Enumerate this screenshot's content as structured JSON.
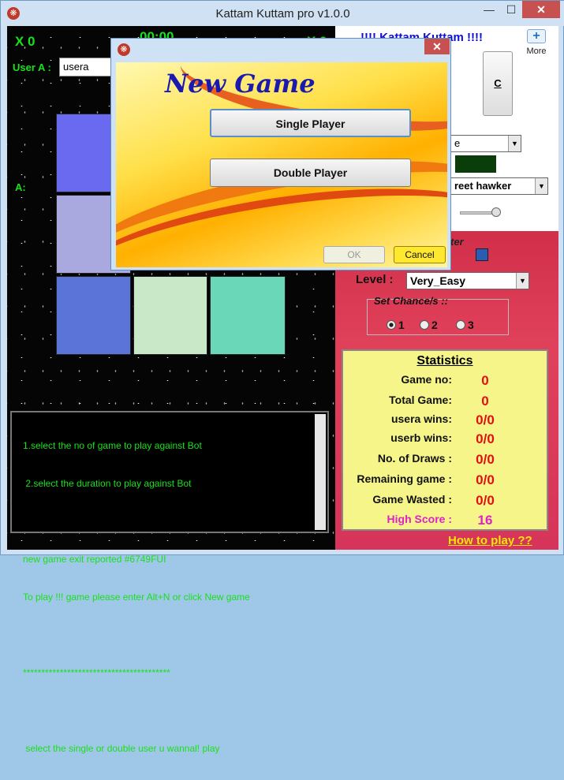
{
  "window": {
    "title": "Kattam Kuttam pro v1.0.0",
    "min_label": "—",
    "max_label": "☐",
    "close_label": "✕"
  },
  "game": {
    "score_x": "X 0",
    "timer": "00:00",
    "score_o": "X 0",
    "user_a_label": "User A :",
    "user_a_value": "usera",
    "a_label": "A:"
  },
  "board": {
    "cell_colors": [
      "#6a6af0",
      "#a9a9e0",
      "#5b74d8",
      "#c8e8c8",
      "#6ad8b8"
    ]
  },
  "log": {
    "lines": [
      "1.select the no of game to play against Bot",
      " 2.select the duration to play against Bot",
      "",
      "new game exit reported #6749FUI",
      "To play !!! game please enter Alt+N or click New game",
      "",
      "****************************************",
      "",
      " select the single or double user u wannal! play"
    ]
  },
  "side": {
    "app_title": "!!!! Kattam Kuttam !!!!",
    "more_label": "More",
    "c_button": "C",
    "theme_select": "e",
    "song_select": "reet hawker",
    "ter_text": "ter",
    "level_label": "Level :",
    "level_value": "Very_Easy",
    "chances_label": "Set Chance/s ::",
    "chances": [
      "1",
      "2",
      "3"
    ],
    "chances_selected": "1",
    "how_to_play": "How to play ??"
  },
  "stats": {
    "title": "Statistics",
    "rows": [
      {
        "label": "Game no:",
        "value": "0"
      },
      {
        "label": "Total Game:",
        "value": "0"
      },
      {
        "label": "usera wins:",
        "value": "0/0"
      },
      {
        "label": "userb wins:",
        "value": "0/0"
      },
      {
        "label": "No. of Draws :",
        "value": "0/0"
      },
      {
        "label": "Remaining game :",
        "value": "0/0"
      },
      {
        "label": "Game Wasted :",
        "value": "0/0"
      },
      {
        "label": "High Score :",
        "value": "16"
      }
    ]
  },
  "dialog": {
    "heading": "New Game",
    "single_button": "Single Player",
    "double_button": "Double Player",
    "ok_button": "OK",
    "cancel_button": "Cancel",
    "close_label": "✕"
  }
}
